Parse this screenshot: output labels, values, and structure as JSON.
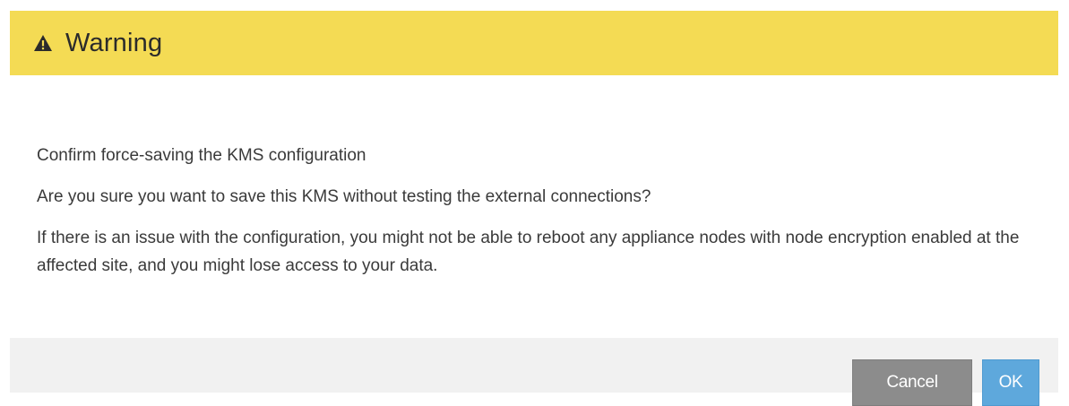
{
  "dialog": {
    "title": "Warning",
    "title_icon": "warning-triangle-icon",
    "header_color": "#f4db54",
    "messages": [
      "Confirm force-saving the KMS configuration",
      "Are you sure you want to save this KMS without testing the external connections?",
      "If there is an issue with the configuration, you might not be able to reboot any appliance nodes with node encryption enabled at the affected site, and you might lose access to your data."
    ],
    "buttons": {
      "cancel_label": "Cancel",
      "ok_label": "OK",
      "cancel_color": "#8c8c8c",
      "ok_color": "#5ea8dc"
    }
  }
}
